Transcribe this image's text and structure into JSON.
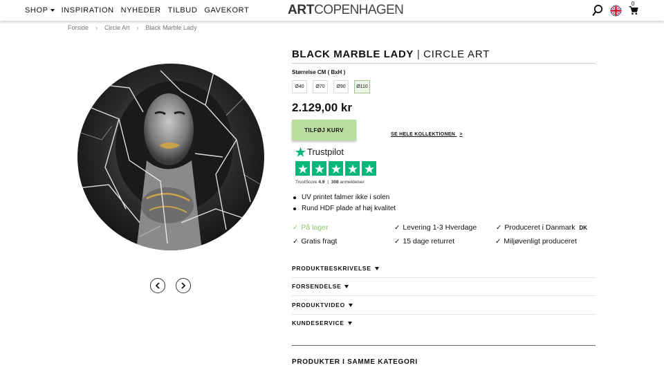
{
  "header": {
    "nav": [
      {
        "label": "SHOP",
        "has_dropdown": true
      },
      {
        "label": "INSPIRATION"
      },
      {
        "label": "NYHEDER"
      },
      {
        "label": "TILBUD"
      },
      {
        "label": "GAVEKORT"
      }
    ],
    "logo_bold": "ART",
    "logo_light": "COPENHAGEN",
    "icons": [
      "search-icon",
      "uk-flag-icon",
      "cart-icon"
    ],
    "cart_count": "0"
  },
  "breadcrumb": [
    "Forside",
    "Circle Art",
    "Black Marble Lady"
  ],
  "product": {
    "name": "BLACK MARBLE LADY",
    "separator": "|",
    "category": "CIRCLE ART",
    "size_label": "Størrelse CM ( BxH )",
    "sizes": [
      "Ø40",
      "Ø70",
      "Ø90",
      "Ø110"
    ],
    "selected_size": "Ø110",
    "price": "2.129,00 kr",
    "add_button": "TILFØJ KURV",
    "collection_link": "SE HELE KOLLEKTIONEN",
    "collection_arrow": ">"
  },
  "trustpilot": {
    "brand": "Trustpilot",
    "rating_stars": 5,
    "score_label": "TrustScore",
    "score": "4.9",
    "divider": "|",
    "reviews": "308",
    "reviews_label": "anmeldelser"
  },
  "bullets": [
    "UV printet falmer ikke i solen",
    "Rund HDF plade af høj kvalitet"
  ],
  "features": {
    "in_stock": "På lager",
    "delivery": "Levering 1-3 Hverdage",
    "produced": "Produceret i Danmark",
    "produced_suffix": "DK",
    "shipping": "Gratis fragt",
    "returns": "15 dage returret",
    "eco": "Miljøvenligt produceret"
  },
  "accordions": [
    "PRODUKTBESKRIVELSE",
    "FORSENDELSE",
    "PRODUKTVIDEO",
    "KUNDESERVICE"
  ],
  "related_heading": "PRODUKTER I SAMME KATEGORI",
  "colors": {
    "accent_green": "#b9dd9b",
    "stock_green": "#8ec46f",
    "trustpilot_green": "#00b67a"
  }
}
